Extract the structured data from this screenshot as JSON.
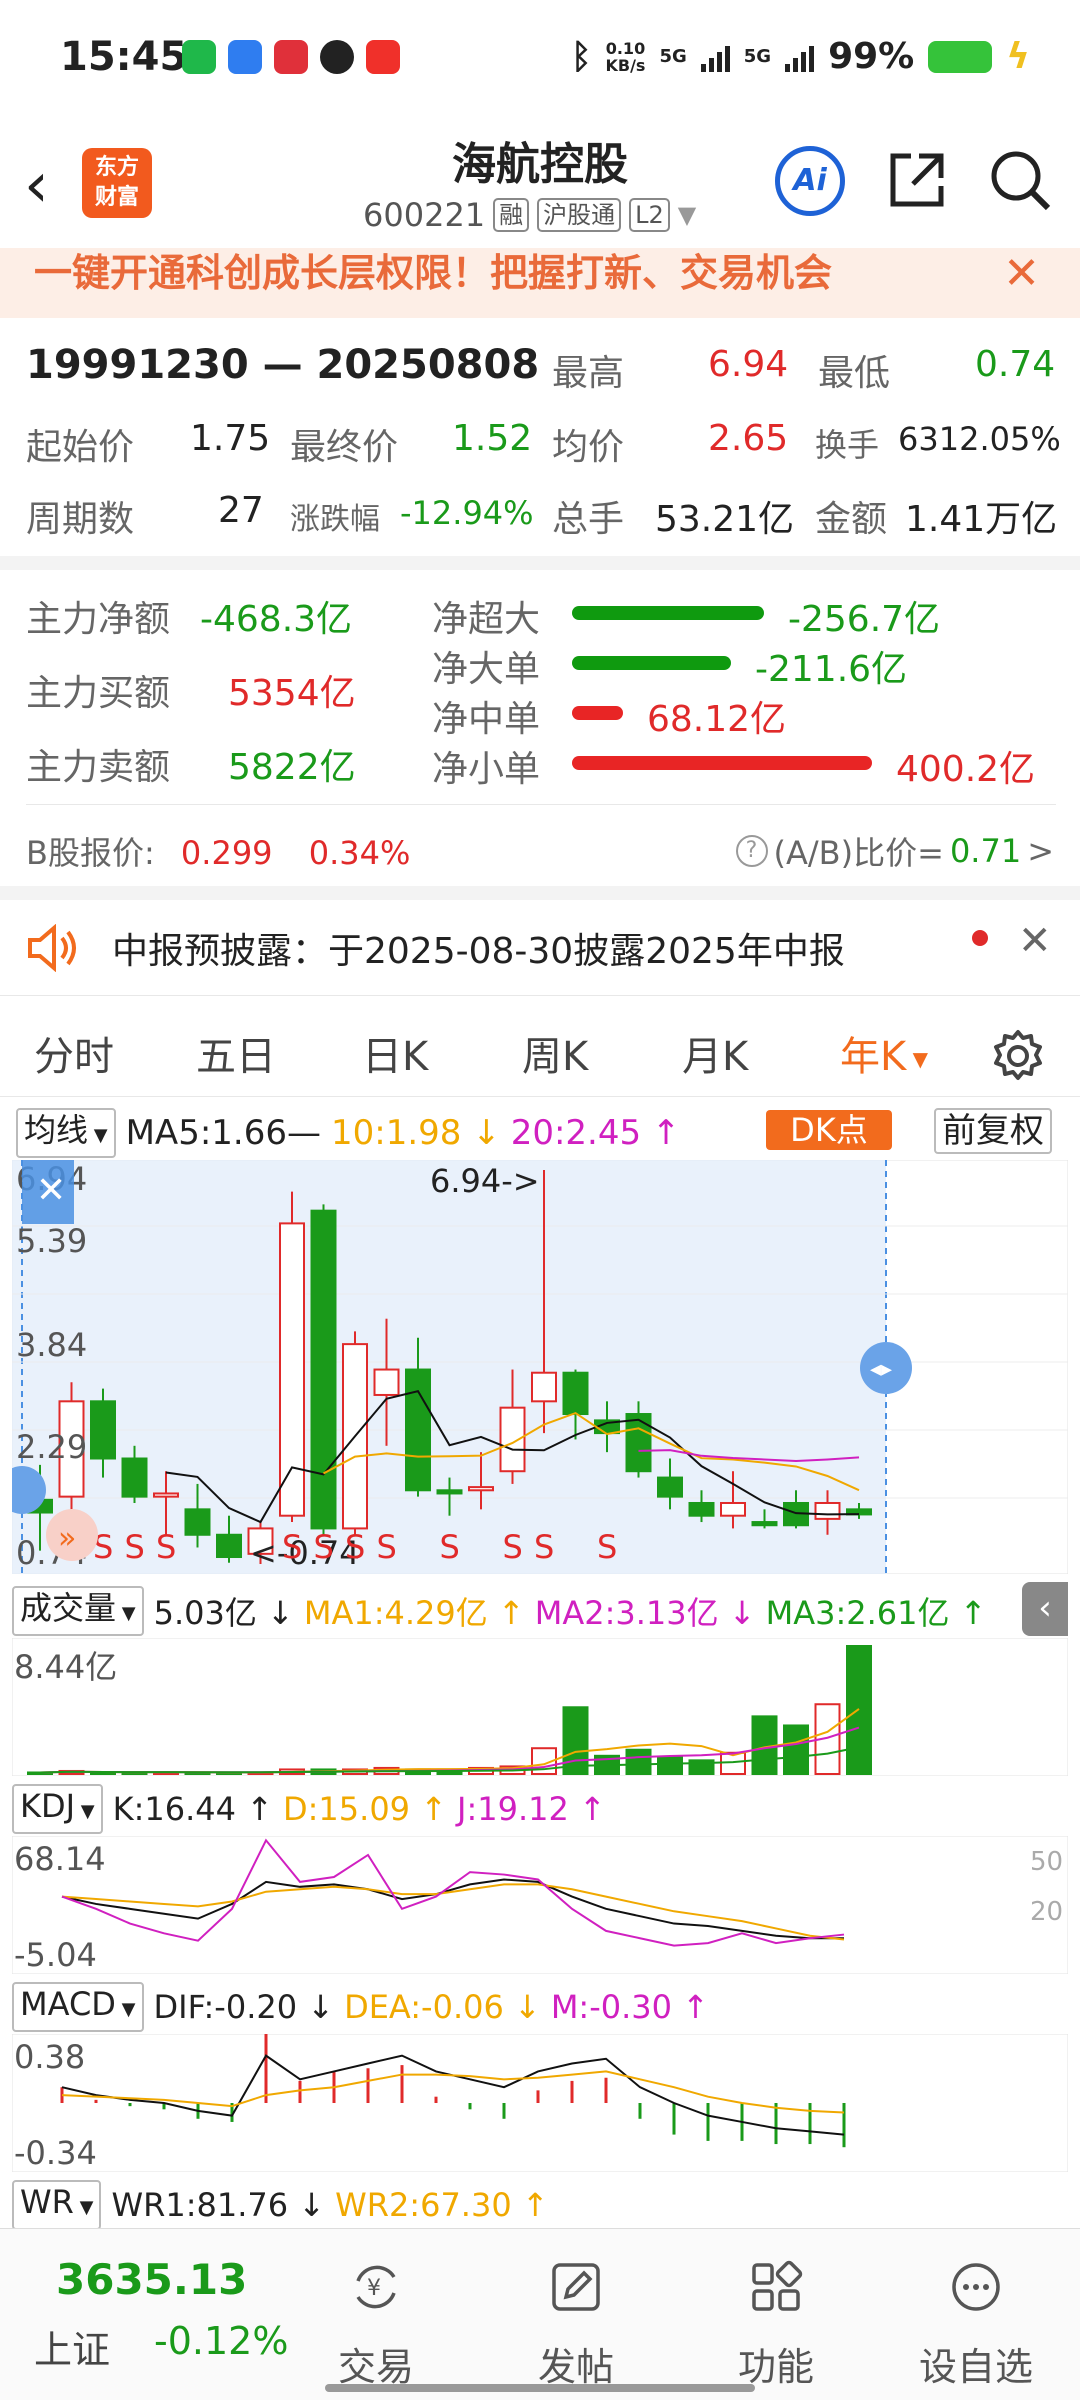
{
  "status_bar": {
    "time": "15:45",
    "net_speed_value": "0.10",
    "net_speed_unit": "KB/s",
    "sim1": "5G",
    "sim2": "5G",
    "battery": "99%"
  },
  "header": {
    "logo_line1": "东方",
    "logo_line2": "财富",
    "title": "海航控股",
    "code": "600221",
    "tag1": "融",
    "tag2": "沪股通",
    "tag3": "L2",
    "ai_label": "Ai"
  },
  "banner": {
    "text": "一键开通科创成长层权限！把握打新、交易机会",
    "close": "✕"
  },
  "period": {
    "range": "19991230 — 20250808",
    "high_label": "最高",
    "high": "6.94",
    "low_label": "最低",
    "low": "0.74",
    "start_label": "起始价",
    "start": "1.75",
    "end_label": "最终价",
    "end": "1.52",
    "avg_label": "均价",
    "avg": "2.65",
    "turnover_label": "换手",
    "turnover": "6312.05%",
    "cycles_label": "周期数",
    "cycles": "27",
    "change_label": "涨跌幅",
    "change": "-12.94%",
    "volume_label": "总手",
    "volume": "53.21亿",
    "amount_label": "金额",
    "amount": "1.41万亿"
  },
  "flow": {
    "net_label": "主力净额",
    "net": "-468.3亿",
    "buy_label": "主力买额",
    "buy": "5354亿",
    "sell_label": "主力卖额",
    "sell": "5822亿",
    "items": [
      {
        "label": "净超大",
        "value": "-256.7亿",
        "color": "#0f9a0f",
        "fraction": 0.64
      },
      {
        "label": "净大单",
        "value": "-211.6亿",
        "color": "#0f9a0f",
        "fraction": 0.53
      },
      {
        "label": "净中单",
        "value": "68.12亿",
        "color": "#e82525",
        "fraction": 0.17
      },
      {
        "label": "净小单",
        "value": "400.2亿",
        "color": "#e82525",
        "fraction": 1.0
      }
    ]
  },
  "b_share": {
    "label": "B股报价:",
    "price": "0.299",
    "change": "0.34%",
    "ratio_label": "(A/B)比价=",
    "ratio": "0.71",
    "arrow": ">"
  },
  "notice": {
    "text": "中报预披露：于2025-08-30披露2025年中报",
    "close": "✕"
  },
  "tabs": [
    "分时",
    "五日",
    "日K",
    "周K",
    "月K",
    "年K"
  ],
  "active_tab": "年K",
  "ma_row": {
    "selector": "均线",
    "ma5": "MA5:1.66—",
    "ma10": "10:1.98 ↓",
    "ma20": "20:2.45 ↑",
    "dk": "DK点",
    "adjust": "前复权"
  },
  "kline_labels": {
    "y1": "6.94",
    "y2": "5.39",
    "y3": "3.84",
    "y4": "2.29",
    "y5": "0.74",
    "high_mark": "6.94->",
    "low_mark": "<-0.74",
    "s": "S"
  },
  "volume_row": {
    "selector": "成交量",
    "vol": "5.03亿 ↓",
    "ma1": "MA1:4.29亿 ↑",
    "ma2": "MA2:3.13亿 ↓",
    "ma3": "MA3:2.61亿 ↑",
    "ymax": "8.44亿"
  },
  "kdj_row": {
    "selector": "KDJ",
    "k": "K:16.44 ↑",
    "d": "D:15.09 ↑",
    "j": "J:19.12 ↑",
    "ytop": "68.14",
    "ybot": "-5.04",
    "r50": "50",
    "r20": "20"
  },
  "macd_row": {
    "selector": "MACD",
    "dif": "DIF:-0.20 ↓",
    "dea": "DEA:-0.06 ↓",
    "m": "M:-0.30 ↑",
    "ytop": "0.38",
    "ybot": "-0.34"
  },
  "wr_row": {
    "selector": "WR",
    "wr1": "WR1:81.76 ↓",
    "wr2": "WR2:67.30 ↑"
  },
  "bottom_nav": {
    "index_value": "3635.13",
    "index_name": "上证",
    "index_change": "-0.12%",
    "items": [
      "交易",
      "发帖",
      "功能",
      "设自选"
    ]
  },
  "colors": {
    "up": "#e02a2a",
    "down": "#1a9a1a",
    "accent": "#f26b1d",
    "brand": "#f25a1e",
    "ai": "#1e62d6"
  }
}
